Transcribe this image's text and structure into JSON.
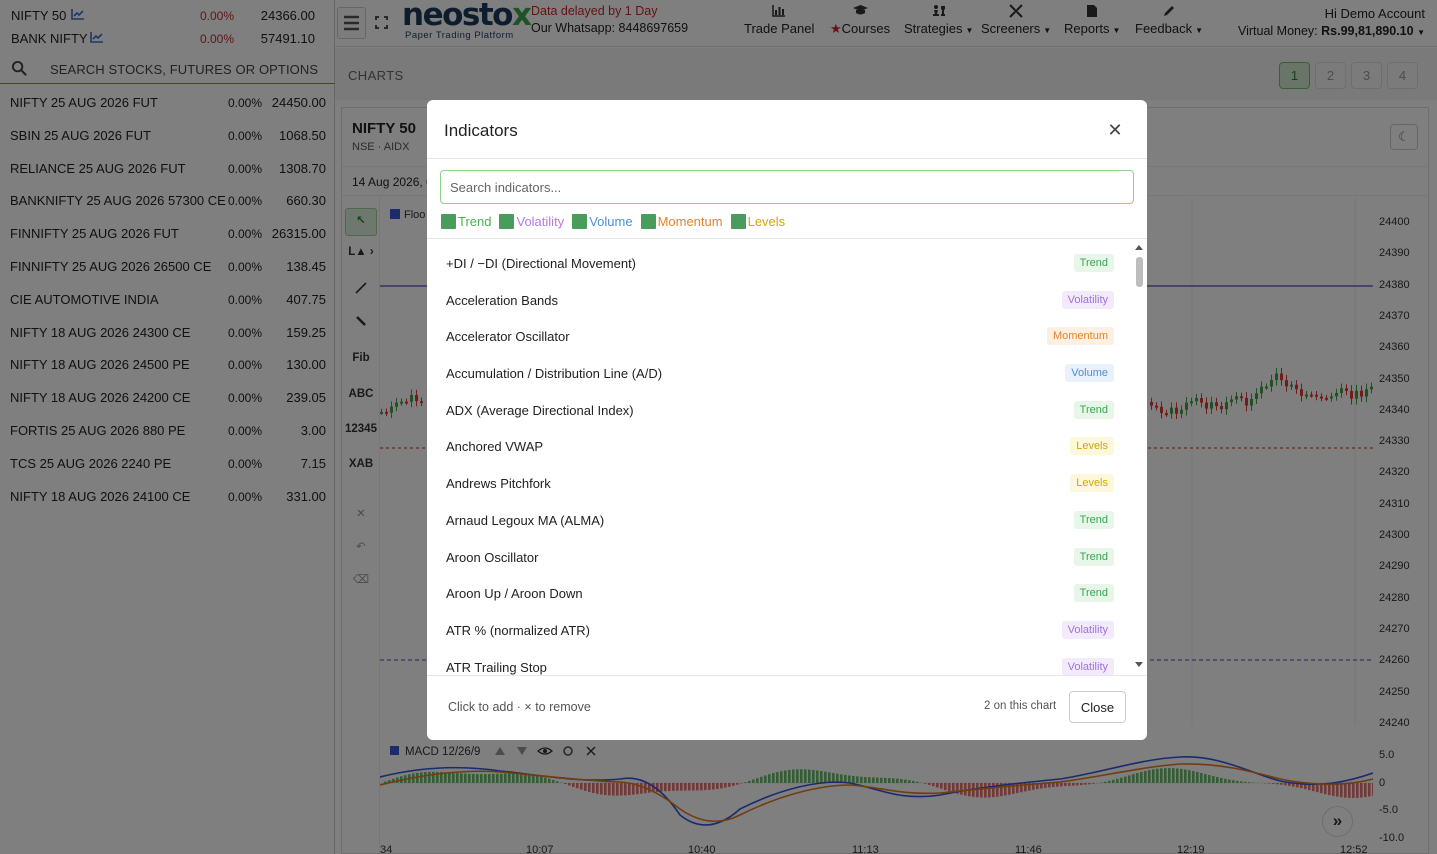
{
  "indices": [
    {
      "name": "NIFTY 50",
      "change": "0.00%",
      "price": "24366.00"
    },
    {
      "name": "BANK NIFTY",
      "change": "0.00%",
      "price": "57491.10"
    }
  ],
  "search": {
    "placeholder": "SEARCH STOCKS, FUTURES OR OPTIONS"
  },
  "watchlist": [
    {
      "name": "NIFTY 25 AUG 2026 FUT",
      "change": "0.00%",
      "price": "24450.00"
    },
    {
      "name": "SBIN 25 AUG 2026 FUT",
      "change": "0.00%",
      "price": "1068.50"
    },
    {
      "name": "RELIANCE 25 AUG 2026 FUT",
      "change": "0.00%",
      "price": "1308.70"
    },
    {
      "name": "BANKNIFTY 25 AUG 2026 57300 CE",
      "change": "0.00%",
      "price": "660.30"
    },
    {
      "name": "FINNIFTY 25 AUG 2026 FUT",
      "change": "0.00%",
      "price": "26315.00"
    },
    {
      "name": "FINNIFTY 25 AUG 2026 26500 CE",
      "change": "0.00%",
      "price": "138.45"
    },
    {
      "name": "CIE AUTOMOTIVE INDIA",
      "change": "0.00%",
      "price": "407.75"
    },
    {
      "name": "NIFTY 18 AUG 2026 24300 CE",
      "change": "0.00%",
      "price": "159.25"
    },
    {
      "name": "NIFTY 18 AUG 2026 24500 PE",
      "change": "0.00%",
      "price": "130.00"
    },
    {
      "name": "NIFTY 18 AUG 2026 24200 CE",
      "change": "0.00%",
      "price": "239.05"
    },
    {
      "name": "FORTIS 25 AUG 2026 880 PE",
      "change": "0.00%",
      "price": "3.00"
    },
    {
      "name": "TCS 25 AUG 2026 2240 PE",
      "change": "0.00%",
      "price": "7.15"
    },
    {
      "name": "NIFTY 18 AUG 2026 24100 CE",
      "change": "0.00%",
      "price": "331.00"
    }
  ],
  "header": {
    "logo_main": "neosto",
    "logo_x": "x",
    "logo_sub": "Paper Trading Platform",
    "delay_text": "Data delayed by 1 Day",
    "whatsapp": "Our Whatsapp: 8448697659",
    "nav": {
      "trade_panel": "Trade Panel",
      "courses": "Courses",
      "strategies": "Strategies",
      "screeners": "Screeners",
      "reports": "Reports",
      "feedback": "Feedback"
    },
    "greeting": "Hi Demo Account",
    "money_label": "Virtual Money:",
    "money_value": "Rs.99,81,890.10"
  },
  "charts_bar": {
    "title": "CHARTS",
    "pages": [
      "1",
      "2",
      "3",
      "4"
    ]
  },
  "chart": {
    "symbol": "NIFTY 50",
    "exchange": "NSE · AIDX",
    "date": "14 Aug 2026, 0",
    "legend_partial": "Floo",
    "theme_icon": "☾",
    "tools": {
      "fib": "Fib",
      "abc": "ABC",
      "num": "12345",
      "xab": "XAB",
      "la": "L▲ ›"
    },
    "y_ticks": [
      "24400",
      "24390",
      "24380",
      "24370",
      "24360",
      "24350",
      "24340",
      "24330",
      "24320",
      "24310",
      "24300",
      "24290",
      "24280",
      "24270",
      "24260",
      "24250",
      "24240"
    ],
    "macd_label": "MACD 12/26/9",
    "macd_ticks": [
      "5.0",
      "0",
      "-5.0",
      "-10.0"
    ],
    "x_ticks": [
      "34",
      "10:07",
      "10:40",
      "11:13",
      "11:46",
      "12:19",
      "12:52"
    ],
    "forward_icon": "»"
  },
  "modal": {
    "title": "Indicators",
    "close_icon": "✕",
    "search_placeholder": "Search indicators...",
    "filters": [
      {
        "label": "Trend",
        "color": "#4caf50"
      },
      {
        "label": "Volatility",
        "color": "#b57ae8"
      },
      {
        "label": "Volume",
        "color": "#4d8fd6"
      },
      {
        "label": "Momentum",
        "color": "#e68422"
      },
      {
        "label": "Levels",
        "color": "#d9a800"
      }
    ],
    "indicators": [
      {
        "name": "+DI / −DI (Directional Movement)",
        "category": "Trend"
      },
      {
        "name": "Acceleration Bands",
        "category": "Volatility"
      },
      {
        "name": "Accelerator Oscillator",
        "category": "Momentum"
      },
      {
        "name": "Accumulation / Distribution Line (A/D)",
        "category": "Volume"
      },
      {
        "name": "ADX (Average Directional Index)",
        "category": "Trend"
      },
      {
        "name": "Anchored VWAP",
        "category": "Levels"
      },
      {
        "name": "Andrews Pitchfork",
        "category": "Levels"
      },
      {
        "name": "Arnaud Legoux MA (ALMA)",
        "category": "Trend"
      },
      {
        "name": "Aroon Oscillator",
        "category": "Trend"
      },
      {
        "name": "Aroon Up / Aroon Down",
        "category": "Trend"
      },
      {
        "name": "ATR % (normalized ATR)",
        "category": "Volatility"
      },
      {
        "name": "ATR Trailing Stop",
        "category": "Volatility"
      }
    ],
    "hint": "Click to add · × to remove",
    "on_chart": "2 on this chart",
    "close_label": "Close"
  }
}
